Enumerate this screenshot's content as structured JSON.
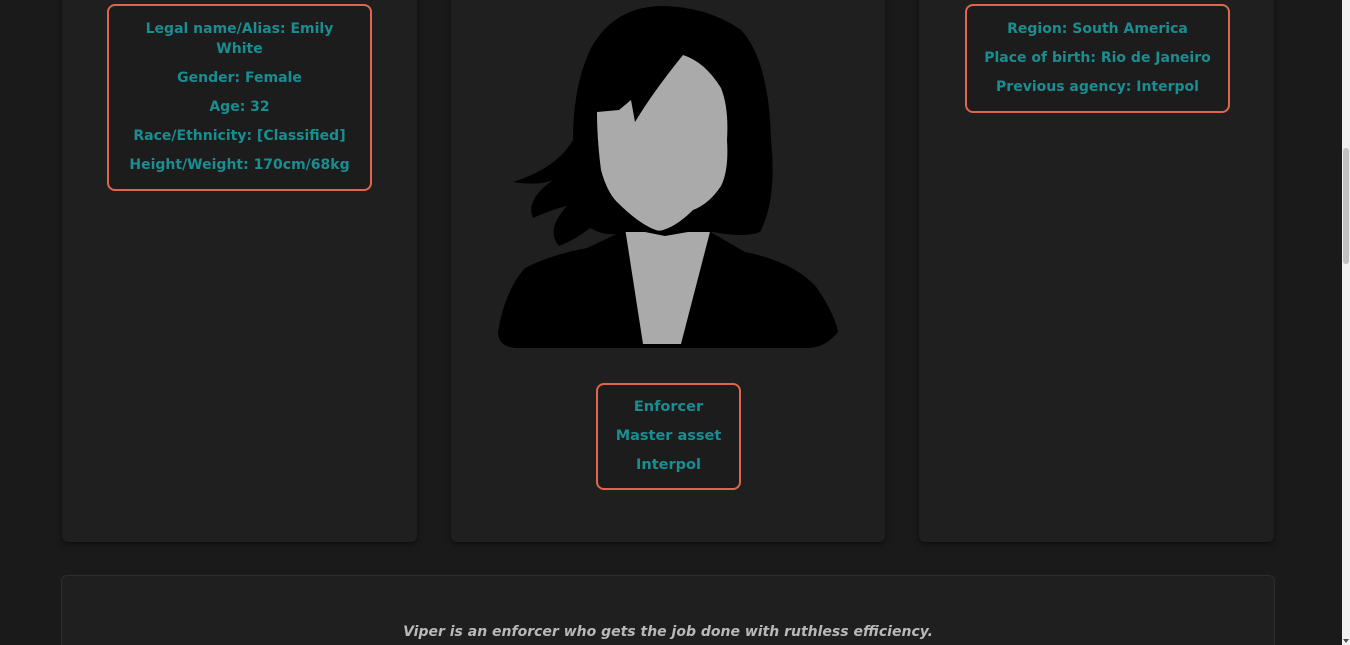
{
  "profile": {
    "details_left": [
      "Legal name/Alias: Emily White",
      "Gender: Female",
      "Age: 32",
      "Race/Ethnicity: [Classified]",
      "Height/Weight: 170cm/68kg"
    ],
    "details_right": [
      "Region: South America",
      "Place of birth: Rio de Janeiro",
      "Previous agency: Interpol"
    ],
    "roles": [
      "Enforcer",
      "Master asset",
      "Interpol"
    ],
    "portrait_icon": "female-silhouette-avatar-icon",
    "bio": "Viper is an enforcer who gets the job done with ruthless efficiency."
  },
  "colors": {
    "background": "#1a1a1a",
    "panel": "#1f1f1f",
    "accent_border": "#e0654c",
    "text_teal": "#1a8d91",
    "bio_text": "#b9b9b9"
  }
}
